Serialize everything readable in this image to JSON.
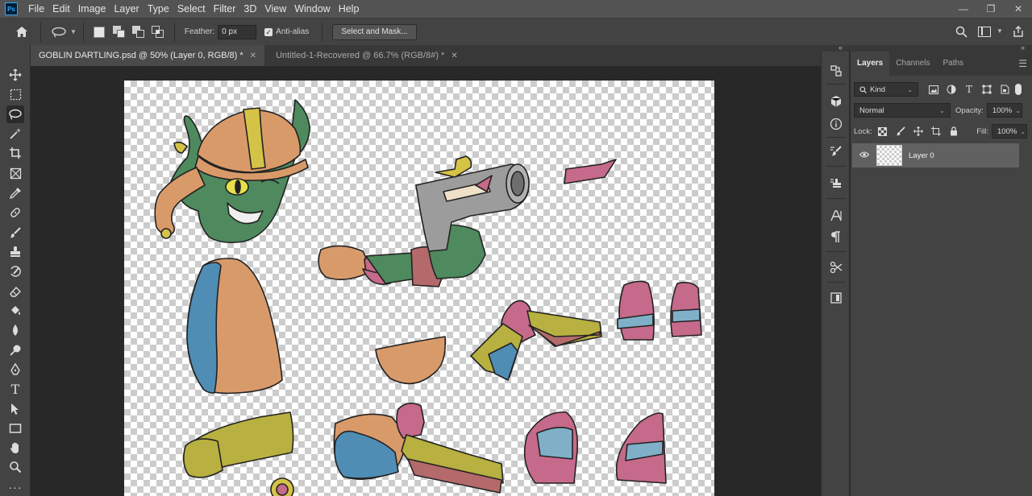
{
  "menubar": {
    "logo": "Ps",
    "items": [
      "File",
      "Edit",
      "Image",
      "Layer",
      "Type",
      "Select",
      "Filter",
      "3D",
      "View",
      "Window",
      "Help"
    ]
  },
  "options": {
    "feather_label": "Feather:",
    "feather_value": "0 px",
    "antialias_label": "Anti-alias",
    "antialias_checked": true,
    "select_mask_label": "Select and Mask..."
  },
  "tabs": [
    {
      "label": "GOBLIN DARTLING.psd @ 50% (Layer 0, RGB/8) *",
      "active": true
    },
    {
      "label": "Untitled-1-Recovered @ 66.7% (RGB/8#) *",
      "active": false
    }
  ],
  "layers_panel": {
    "tabs": [
      "Layers",
      "Channels",
      "Paths"
    ],
    "filter_label": "Kind",
    "blend_mode": "Normal",
    "opacity_label": "Opacity:",
    "opacity_value": "100%",
    "lock_label": "Lock:",
    "fill_label": "Fill:",
    "fill_value": "100%",
    "layers": [
      {
        "name": "Layer 0",
        "visible": true
      }
    ]
  },
  "colors": {
    "accent": "#31a8ff",
    "goblin_green": "#4e8a5e",
    "skin_orange": "#d99a6a",
    "teal_blue": "#4f8db5",
    "pink": "#c56a8a",
    "yellow_olive": "#b8b040",
    "gray_metal": "#9c9c9c"
  }
}
